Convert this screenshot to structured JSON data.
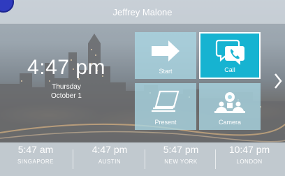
{
  "header": {
    "user_name": "Jeffrey Malone"
  },
  "clock": {
    "time": "4:47 pm",
    "day": "Thursday",
    "date": "October 1"
  },
  "tiles": [
    {
      "label": "Start",
      "icon": "arrow-right-icon"
    },
    {
      "label": "Call",
      "icon": "chat-phone-icon"
    },
    {
      "label": "Present",
      "icon": "laptop-icon"
    },
    {
      "label": "Camera",
      "icon": "conference-camera-icon"
    }
  ],
  "world_clocks": [
    {
      "time": "5:47 am",
      "city": "SINGAPORE"
    },
    {
      "time": "4:47 pm",
      "city": "AUSTIN"
    },
    {
      "time": "5:47 pm",
      "city": "NEW YORK"
    },
    {
      "time": "10:47 pm",
      "city": "LONDON"
    }
  ],
  "colors": {
    "active_tile": "#16b3d1",
    "tile": "#aad7e4",
    "logo": "#2f3bbf"
  }
}
